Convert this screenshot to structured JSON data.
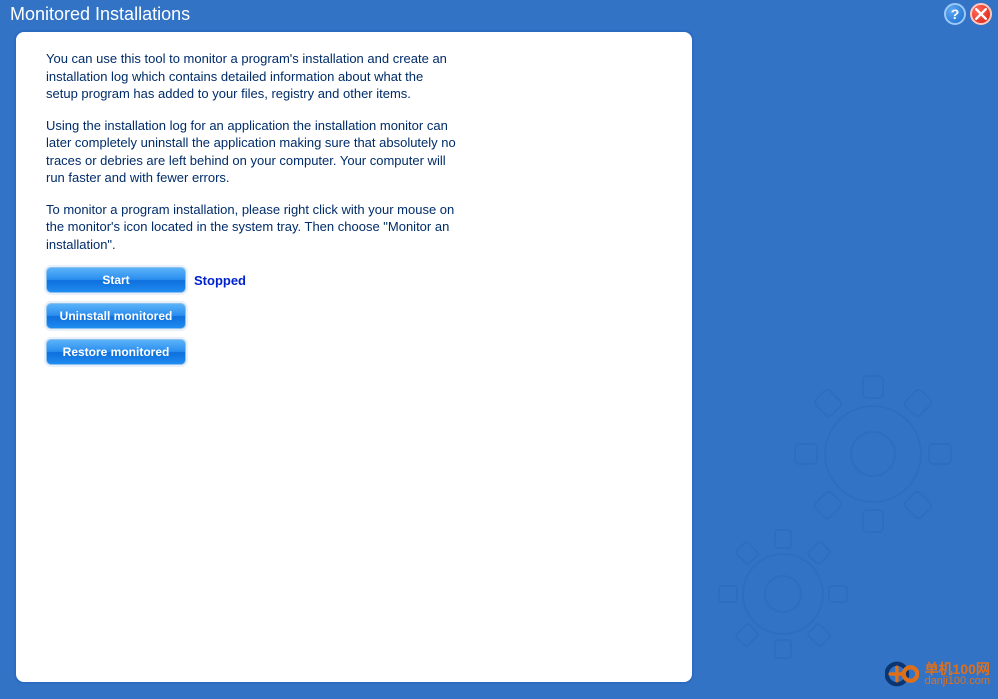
{
  "header": {
    "title": "Monitored Installations",
    "help_label": "?"
  },
  "content": {
    "paragraph1": "You can use this tool to monitor a program's installation and create an installation log which contains detailed information about what the setup program has added to your files, registry and other items.",
    "paragraph2": "Using the installation log for an application the installation monitor can later completely uninstall the application making sure that absolutely no traces or debries are left behind on your computer. Your computer will run faster and with fewer errors.",
    "paragraph3": "To monitor a program installation, please right click with your mouse on the monitor's icon located in the system tray. Then choose \"Monitor an installation\"."
  },
  "buttons": {
    "start": "Start",
    "uninstall": "Uninstall monitored",
    "restore": "Restore monitored"
  },
  "status": {
    "text": "Stopped"
  },
  "watermark": {
    "cn": "单机100网",
    "url": "danji100.com"
  }
}
